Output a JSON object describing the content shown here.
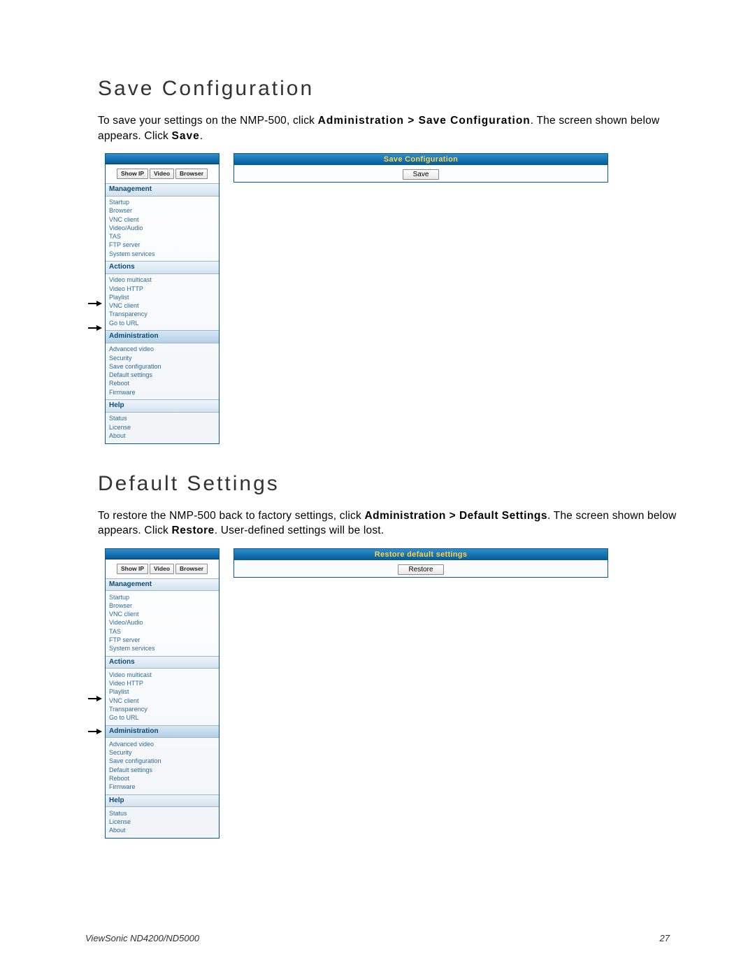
{
  "section1": {
    "heading": "Save Configuration",
    "para_part1": "To save your settings on the NMP-500, click ",
    "para_bold1": "Administration > Save Configuration",
    "para_part2": ". The screen shown below appears. Click ",
    "para_bold2": "Save",
    "para_part3": "."
  },
  "ui1": {
    "panel_title": "Save Configuration",
    "panel_button": "Save",
    "tabs": {
      "show_ip": "Show IP",
      "video": "Video",
      "browser": "Browser"
    },
    "groups": {
      "management": {
        "title": "Management",
        "items": [
          "Startup",
          "Browser",
          "VNC client",
          "Video/Audio",
          "TAS",
          "FTP server",
          "System services"
        ]
      },
      "actions": {
        "title": "Actions",
        "items": [
          "Video multicast",
          "Video HTTP",
          "Playlist",
          "VNC client",
          "Transparency",
          "Go to URL"
        ]
      },
      "administration": {
        "title": "Administration",
        "items": [
          "Advanced video",
          "Security",
          "Save configuration",
          "Default settings",
          "Reboot",
          "Firmware"
        ]
      },
      "help": {
        "title": "Help",
        "items": [
          "Status",
          "License",
          "About"
        ]
      }
    }
  },
  "section2": {
    "heading": "Default Settings",
    "para_part1": "To restore the NMP-500 back to factory settings, click ",
    "para_bold1": "Administration > Default Settings",
    "para_part2": ". The screen shown below appears. Click ",
    "para_bold2": "Restore",
    "para_part3": ". User-defined settings will be lost."
  },
  "ui2": {
    "panel_title": "Restore default settings",
    "panel_button": "Restore",
    "tabs": {
      "show_ip": "Show IP",
      "video": "Video",
      "browser": "Browser"
    },
    "groups": {
      "management": {
        "title": "Management",
        "items": [
          "Startup",
          "Browser",
          "VNC client",
          "Video/Audio",
          "TAS",
          "FTP server",
          "System services"
        ]
      },
      "actions": {
        "title": "Actions",
        "items": [
          "Video multicast",
          "Video HTTP",
          "Playlist",
          "VNC client",
          "Transparency",
          "Go to URL"
        ]
      },
      "administration": {
        "title": "Administration",
        "items": [
          "Advanced video",
          "Security",
          "Save configuration",
          "Default settings",
          "Reboot",
          "Firmware"
        ]
      },
      "help": {
        "title": "Help",
        "items": [
          "Status",
          "License",
          "About"
        ]
      }
    }
  },
  "footer": {
    "left": "ViewSonic ND4200/ND5000",
    "right": "27"
  }
}
